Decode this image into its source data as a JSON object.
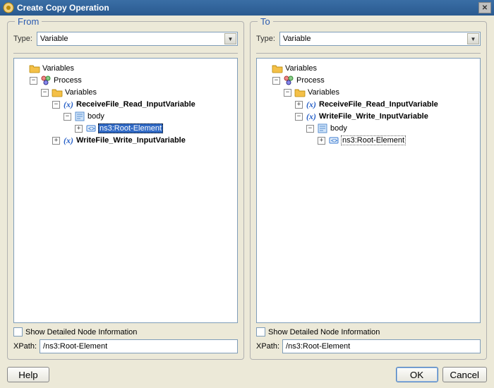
{
  "titlebar": {
    "title": "Create Copy Operation"
  },
  "from": {
    "heading": "From",
    "type_label": "Type:",
    "type_value": "Variable",
    "tree": {
      "root": "Variables",
      "process": "Process",
      "vars": "Variables",
      "recv": "ReceiveFile_Read_InputVariable",
      "body": "body",
      "rootelem": "ns3:Root-Element",
      "write": "WriteFile_Write_InputVariable"
    },
    "show_detail": "Show Detailed Node Information",
    "show_detail_checked": false,
    "xpath_label": "XPath:",
    "xpath_value": "/ns3:Root-Element"
  },
  "to": {
    "heading": "To",
    "type_label": "Type:",
    "type_value": "Variable",
    "tree": {
      "root": "Variables",
      "process": "Process",
      "vars": "Variables",
      "recv": "ReceiveFile_Read_InputVariable",
      "write": "WriteFile_Write_InputVariable",
      "body": "body",
      "rootelem": "ns3:Root-Element"
    },
    "show_detail": "Show Detailed Node Information",
    "show_detail_checked": false,
    "xpath_label": "XPath:",
    "xpath_value": "/ns3:Root-Element"
  },
  "buttons": {
    "help": "Help",
    "ok": "OK",
    "cancel": "Cancel"
  },
  "icons": {
    "folder_color": "#f4c048",
    "xvar_color": "#2a62c8",
    "part_color": "#6aa0e0",
    "elem_color": "#3a7ad0"
  }
}
